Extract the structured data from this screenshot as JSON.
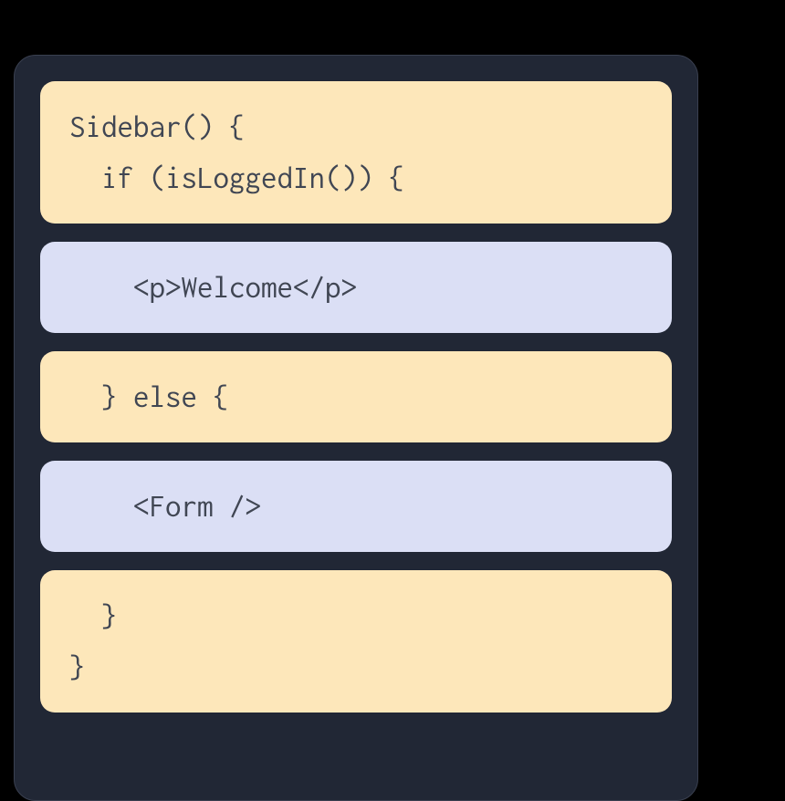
{
  "blocks": {
    "block1": {
      "line1": "Sidebar() {",
      "line2": "  if (isLoggedIn()) {"
    },
    "block2": "    <p>Welcome</p>",
    "block3": "  } else {",
    "block4": "    <Form />",
    "block5": {
      "line1": "  }",
      "line2": "}"
    }
  }
}
